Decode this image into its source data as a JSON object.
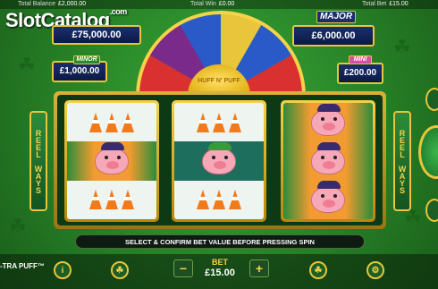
{
  "topbar": {
    "balance_label": "Total Balance",
    "balance_value": "£2,000.00",
    "win_label": "Total Win",
    "win_value": "£0.00",
    "bet_label": "Total Bet",
    "bet_value": "£15.00"
  },
  "watermark": {
    "text": "SlotCatalog",
    "suffix": ".com"
  },
  "jackpots": {
    "grand_value": "£75,000.00",
    "major_label": "MAJOR",
    "major_value": "£6,000.00",
    "minor_label": "MINOR",
    "minor_value": "£1,000.00",
    "mini_label": "MINI",
    "mini_value": "£200.00"
  },
  "wheel": {
    "center_text": "HUFF N' PUFF"
  },
  "side_labels": {
    "left": "REEL WAYS",
    "right": "REEL WAYS"
  },
  "reels": [
    [
      "cones",
      "pig",
      "cones"
    ],
    [
      "cones",
      "pig",
      "cones"
    ],
    [
      "pig",
      "pig",
      "pig"
    ]
  ],
  "message": "SELECT & CONFIRM BET VALUE BEFORE PRESSING SPIN",
  "bottom": {
    "game_title": "-TRA PUFF™",
    "bet_label": "BET",
    "bet_value": "£15.00",
    "info_icon": "info-icon",
    "settings_icon": "gear-icon"
  },
  "colors": {
    "gold": "#e8c53a",
    "felt": "#2a8a2a",
    "jackpot_bg": "#1a2f6e"
  }
}
